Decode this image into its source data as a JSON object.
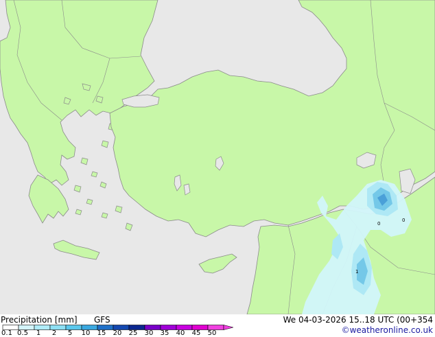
{
  "map": {
    "region_labels": [],
    "colors": {
      "sea": "#e8e8e8",
      "land": "#c8f7a8",
      "coast": "#8a8a8a",
      "border": "#8a8a8a",
      "precip_light": "#d2f6fa",
      "precip_mid": "#aee8f5",
      "precip_heavy": "#74c8e8",
      "precip_core": "#4aa0d8"
    },
    "point_labels": [
      {
        "text": "1"
      },
      {
        "text": "0"
      },
      {
        "text": "0"
      }
    ]
  },
  "footer": {
    "title": "Precipitation [mm]",
    "model": "GFS",
    "datetime": "We 04-03-2026 15..18 UTC (00+354",
    "credit": "©weatheronline.co.uk"
  },
  "legend": {
    "ticks": [
      "0.1",
      "0.5",
      "1",
      "2",
      "5",
      "10",
      "15",
      "20",
      "25",
      "30",
      "35",
      "40",
      "45",
      "50"
    ],
    "colors": [
      "#ffffff",
      "#d4f4fa",
      "#b0ecf8",
      "#8ee0f4",
      "#5cc8ec",
      "#3aa8e0",
      "#2070c8",
      "#1448b0",
      "#0c2890",
      "#7800c8",
      "#a000d8",
      "#c800e0",
      "#e000d0",
      "#f040e0"
    ]
  }
}
